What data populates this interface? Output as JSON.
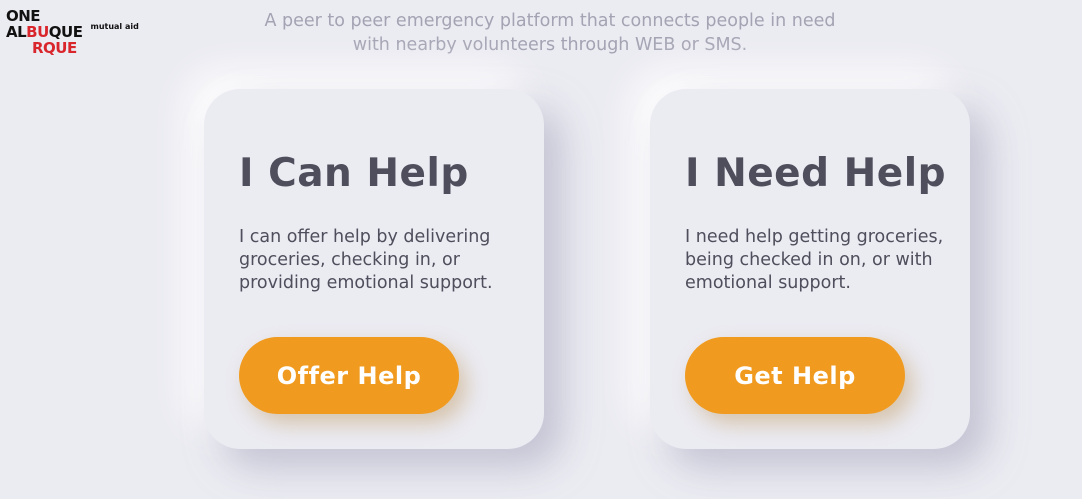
{
  "logo": {
    "line1": "ONE",
    "line2_black": "AL",
    "line2_red": "BU",
    "line2_black2": "QUE",
    "line3": "RQUE",
    "tag": "mutual aid"
  },
  "header": {
    "tagline": "A peer to peer emergency platform that connects people in need with nearby volunteers through WEB or SMS."
  },
  "cards": [
    {
      "title": "I Can Help",
      "description": "I can offer help by delivering groceries, checking in, or providing emotional support.",
      "button_label": "Offer Help"
    },
    {
      "title": "I Need Help",
      "description": "I need help getting groceries, being checked in on, or with emotional support.",
      "button_label": "Get Help"
    }
  ],
  "colors": {
    "background": "#ebebf2",
    "accent": "#f09b1f",
    "brand_red": "#d9262c",
    "text": "#4e4e5c",
    "tagline": "#a3a3b3"
  }
}
